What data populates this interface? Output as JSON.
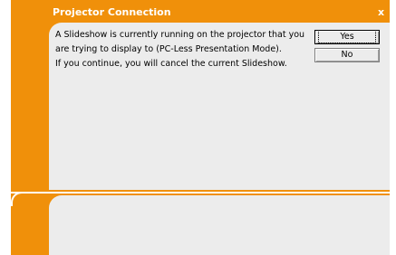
{
  "dialog": {
    "title": "Projector Connection",
    "close_label": "x"
  },
  "message": {
    "line1": "A Slideshow is currently running on the projector that you",
    "line2": "are trying to display to (PC-Less Presentation Mode).",
    "line3": "If you continue, you will cancel the current Slideshow."
  },
  "buttons": {
    "yes_label": "Yes",
    "no_label": "No"
  },
  "colors": {
    "frame": "#f0900a",
    "panel": "#ececec",
    "title_text": "#ffffff"
  }
}
